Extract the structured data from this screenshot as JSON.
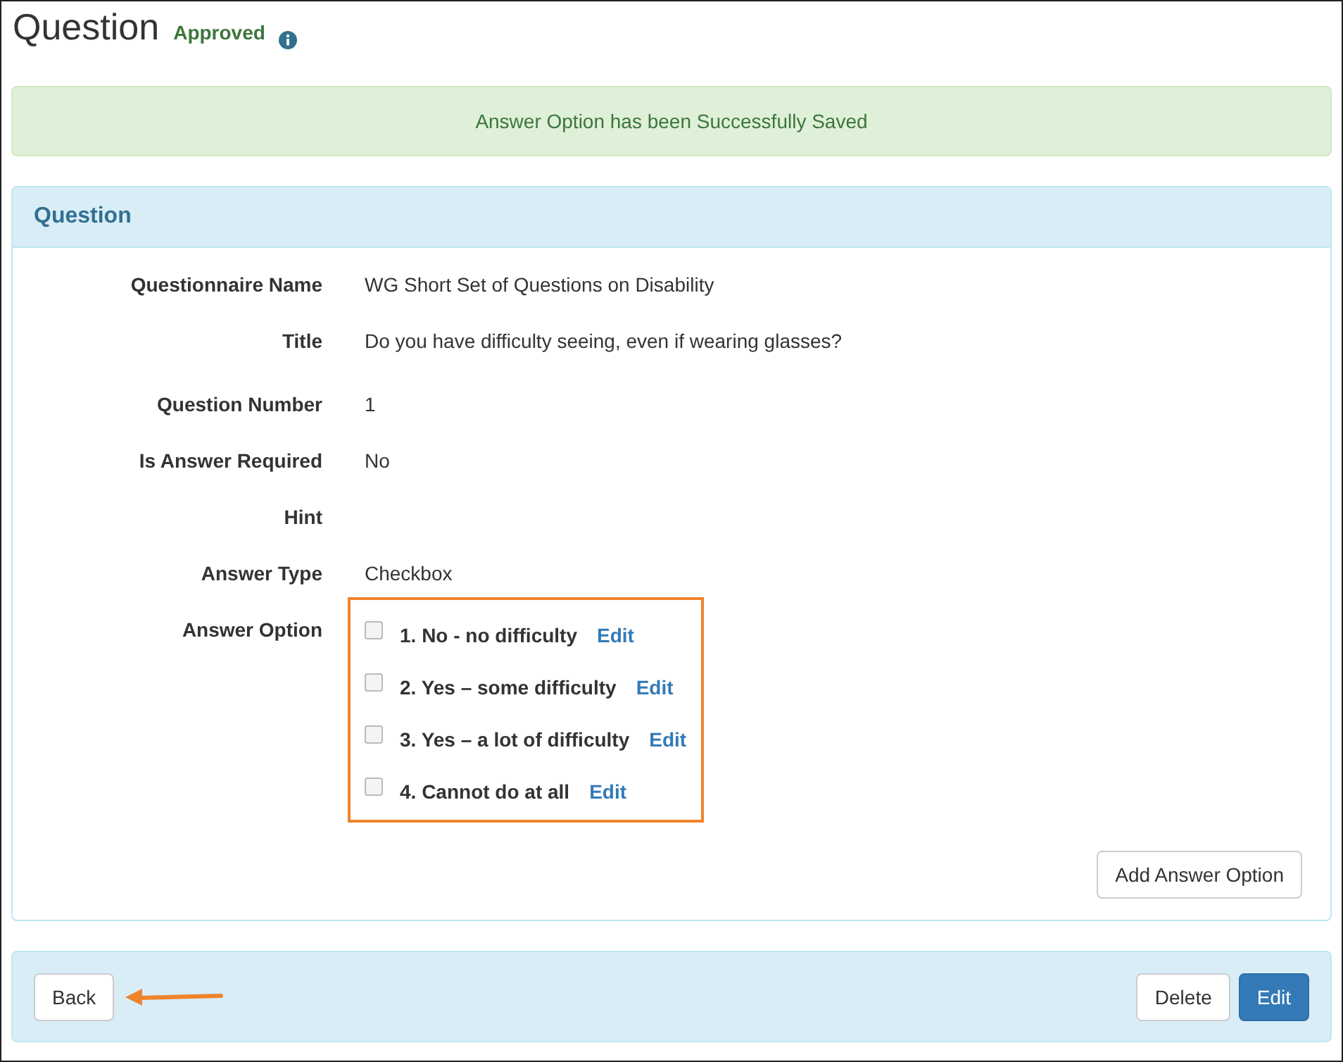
{
  "page": {
    "title": "Question",
    "status": "Approved"
  },
  "alert": {
    "message": "Answer Option has been Successfully Saved"
  },
  "panel": {
    "heading": "Question",
    "fields": [
      {
        "label": "Questionnaire Name",
        "value": "WG Short Set of Questions on Disability"
      },
      {
        "label": "Title",
        "value": "Do you have difficulty seeing, even if wearing glasses?"
      },
      {
        "label": "Question Number",
        "value": "1"
      },
      {
        "label": "Is Answer Required",
        "value": "No"
      },
      {
        "label": "Hint"
      },
      {
        "label": "Answer Type",
        "value": "Checkbox"
      }
    ],
    "answer_option_label": "Answer Option",
    "answer_options": [
      {
        "label": "1. No - no difficulty",
        "checked": false,
        "link": "Edit"
      },
      {
        "label": "2. Yes – some difficulty",
        "checked": false,
        "link": "Edit"
      },
      {
        "label": "3. Yes – a lot of difficulty",
        "checked": false,
        "link": "Edit"
      },
      {
        "label": "4. Cannot do at all",
        "checked": false,
        "link": "Edit"
      }
    ],
    "add_button": "Add Answer Option"
  },
  "footer": {
    "back_button": "Back",
    "delete_button": "Delete",
    "edit_button": "Edit"
  }
}
